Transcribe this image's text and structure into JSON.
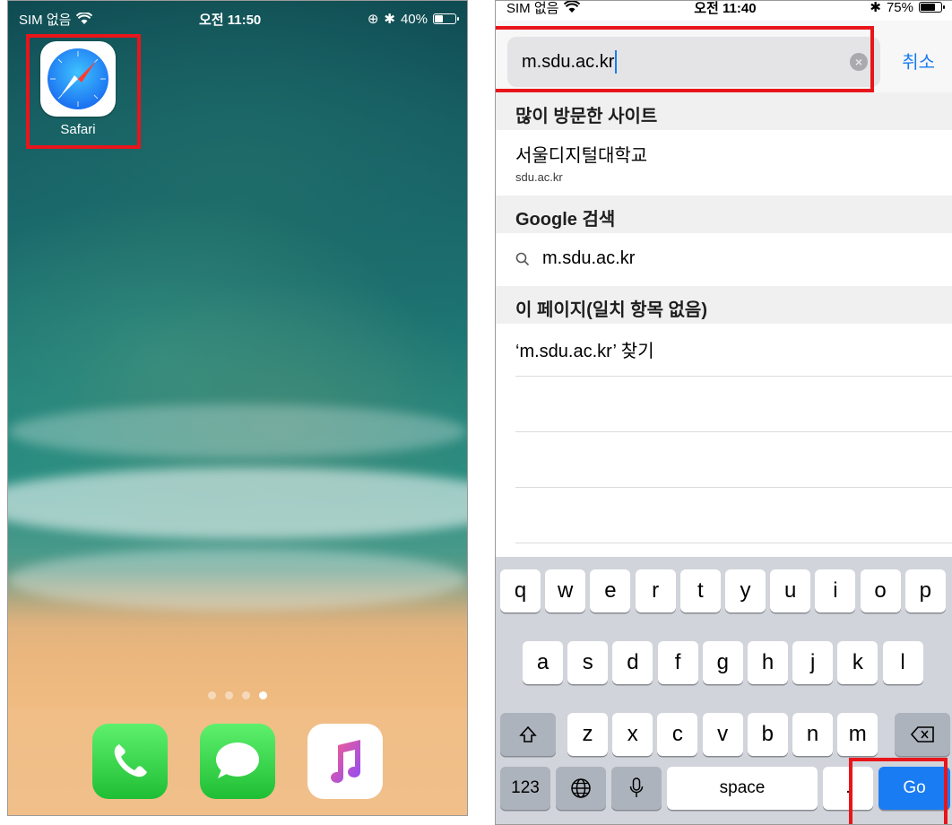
{
  "home": {
    "status": {
      "carrier": "SIM 없음",
      "time": "오전 11:50",
      "battery": "40%",
      "battery_level": 0.4
    },
    "app": {
      "label": "Safari"
    },
    "dock": {
      "icons": [
        "phone-icon",
        "messages-icon",
        "music-icon"
      ]
    },
    "page_dots": {
      "count": 4,
      "active": 4
    }
  },
  "safari": {
    "status": {
      "carrier": "SIM 없음",
      "time": "오전 11:40",
      "battery": "75%",
      "battery_level": 0.75
    },
    "url": "m.sdu.ac.kr",
    "cancel": "취소",
    "sections": {
      "frequent": "많이 방문한 사이트",
      "google": "Google 검색",
      "page": "이 페이지(일치 항목 없음)"
    },
    "frequent_item": {
      "title": "서울디지털대학교",
      "url": "sdu.ac.kr"
    },
    "google_query": "m.sdu.ac.kr",
    "find_text": "‘m.sdu.ac.kr’ 찾기"
  },
  "keyboard": {
    "row1": [
      "q",
      "w",
      "e",
      "r",
      "t",
      "y",
      "u",
      "i",
      "o",
      "p"
    ],
    "row2": [
      "a",
      "s",
      "d",
      "f",
      "g",
      "h",
      "j",
      "k",
      "l"
    ],
    "row3": [
      "z",
      "x",
      "c",
      "v",
      "b",
      "n",
      "m"
    ],
    "numbers": "123",
    "space": "space",
    "period": ".",
    "go": "Go"
  },
  "colors": {
    "highlight": "#e8151b",
    "accent": "#1a7cf2"
  }
}
